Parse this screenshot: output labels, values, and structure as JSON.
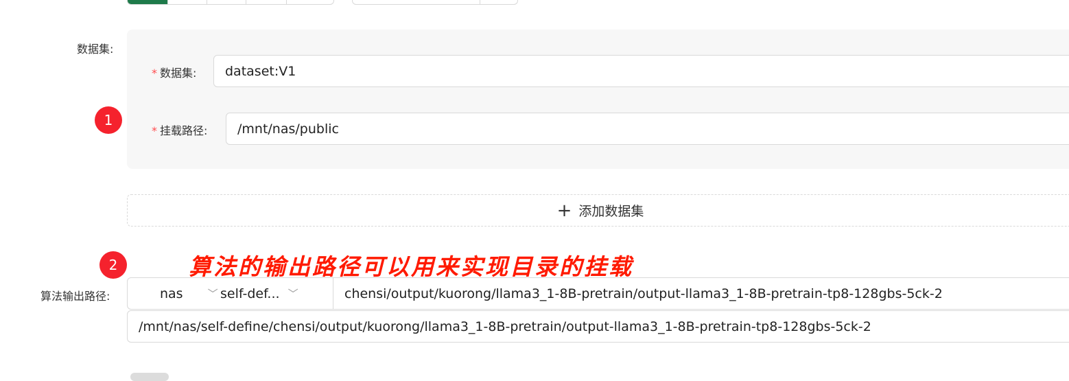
{
  "form": {
    "dataset_section_label": "数据集:",
    "dataset_field_label": "数据集:",
    "dataset_value": "dataset:V1",
    "mount_path_label": "挂载路径:",
    "mount_path_value": "/mnt/nas/public",
    "add_dataset_label": "添加数据集",
    "output_path_label": "算法输出路径:",
    "output_storage_select": "nas",
    "output_dir_select": "self-def...",
    "output_subpath_value": "chensi/output/kuorong/llama3_1-8B-pretrain/output-llama3_1-8B-pretrain-tp8-128gbs-5ck-2",
    "output_full_path": "/mnt/nas/self-define/chensi/output/kuorong/llama3_1-8B-pretrain/output-llama3_1-8B-pretrain-tp8-128gbs-5ck-2",
    "required_mark": "*"
  },
  "annotations": {
    "badge_1": "1",
    "badge_2": "2",
    "note": "算法的输出路径可以用来实现目录的挂载"
  },
  "icons": {
    "plus": "plus-icon",
    "chevron": "chevron-down-icon"
  },
  "colors": {
    "accent_green": "#1e7a4a",
    "annotation_red": "#ff1a00",
    "badge_red": "#f5222d",
    "required_red": "#ff4d4f"
  }
}
